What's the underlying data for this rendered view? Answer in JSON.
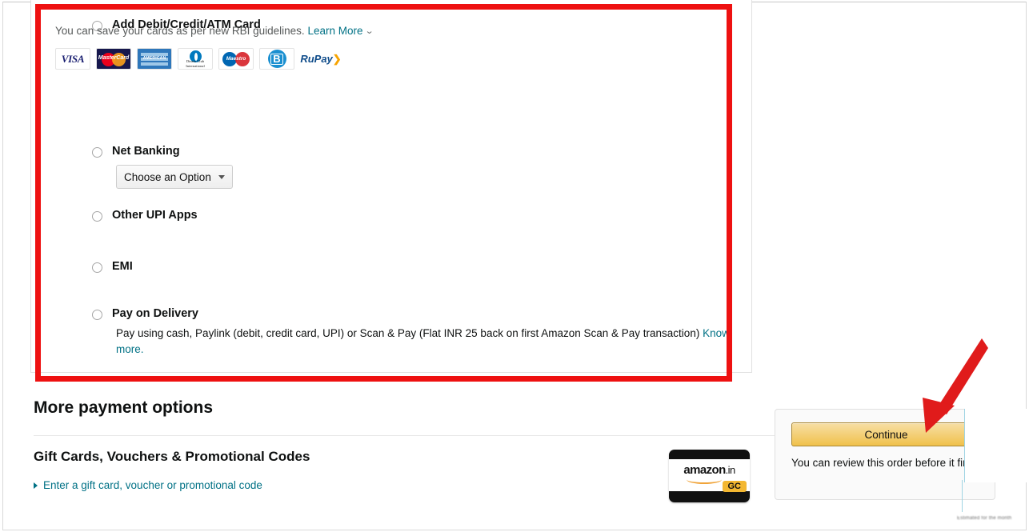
{
  "payment_options": [
    {
      "id": "add-card",
      "label": "Add Debit/Credit/ATM Card",
      "note_text": "You can save your cards as per new RBI guidelines.",
      "note_link": "Learn More",
      "chevron": "chevron-down-icon",
      "selected": false,
      "card_logos": [
        {
          "name": "visa-logo",
          "text": "VISA"
        },
        {
          "name": "mastercard-logo",
          "text": "MasterCard"
        },
        {
          "name": "american-express-logo",
          "text": "AMERICAN EXPRESS"
        },
        {
          "name": "diners-club-logo",
          "text": "Diners Club International"
        },
        {
          "name": "maestro-logo",
          "text": "Maestro"
        },
        {
          "name": "bharat-qr-logo",
          "text": "B"
        },
        {
          "name": "rupay-logo",
          "text": "RuPay"
        }
      ]
    },
    {
      "id": "net-banking",
      "label": "Net Banking",
      "selected": false,
      "dropdown": {
        "value": "Choose an Option",
        "caret": "caret-down-icon"
      }
    },
    {
      "id": "other-upi-apps",
      "label": "Other UPI Apps",
      "selected": false
    },
    {
      "id": "emi",
      "label": "EMI",
      "selected": false
    },
    {
      "id": "pay-on-delivery",
      "label": "Pay on Delivery",
      "selected": false,
      "description": "Pay using cash, Paylink (debit, credit card, UPI) or Scan & Pay (Flat INR 25 back on first Amazon Scan & Pay transaction)",
      "description_link": "Know more."
    }
  ],
  "more_payment": {
    "heading": "More payment options",
    "gift_cards_heading": "Gift Cards, Vouchers & Promotional Codes",
    "gift_card_link": "Enter a gift card, voucher or promotional code",
    "expander_icon": "triangle-right-icon",
    "gift_card_image": {
      "name": "amazon-gift-card-image",
      "brand": "amazon",
      "tld": ".in",
      "badge": "GC"
    }
  },
  "order_box": {
    "continue_label": "Continue",
    "note": "You can review this order before it final."
  },
  "annotations": {
    "highlight_box": {
      "name": "red-highlight-rectangle",
      "color": "#ee1111"
    },
    "arrow": {
      "name": "red-pointer-arrow",
      "color": "#e01b1b"
    }
  },
  "footer_blurred_text": "Estimated for the month"
}
